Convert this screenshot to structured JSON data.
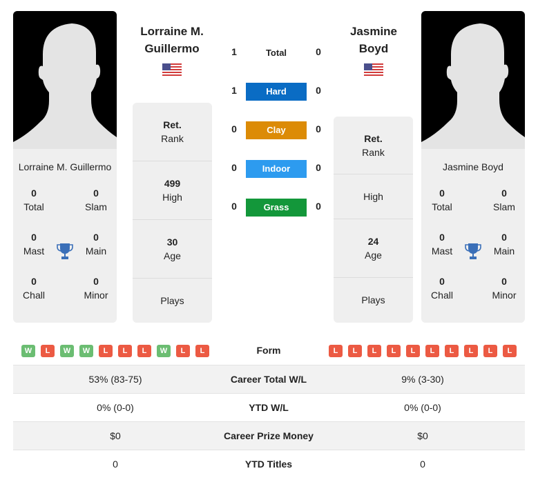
{
  "players": [
    {
      "name_line1": "Lorraine M.",
      "name_line2": "Guillermo",
      "full_name": "Lorraine M. Guillermo",
      "country_flag": "us-flag-icon",
      "titles": {
        "total": {
          "value": "0",
          "label": "Total"
        },
        "slam": {
          "value": "0",
          "label": "Slam"
        },
        "mast": {
          "value": "0",
          "label": "Mast"
        },
        "main": {
          "value": "0",
          "label": "Main"
        },
        "chall": {
          "value": "0",
          "label": "Chall"
        },
        "minor": {
          "value": "0",
          "label": "Minor"
        }
      },
      "stats": {
        "rank": {
          "value": "Ret.",
          "label": "Rank"
        },
        "high": {
          "value": "499",
          "label": "High"
        },
        "age": {
          "value": "30",
          "label": "Age"
        },
        "plays": {
          "value": "",
          "label": "Plays"
        }
      },
      "form": [
        "W",
        "L",
        "W",
        "W",
        "L",
        "L",
        "L",
        "W",
        "L",
        "L"
      ]
    },
    {
      "name_line1": "Jasmine",
      "name_line2": "Boyd",
      "full_name": "Jasmine Boyd",
      "country_flag": "us-flag-icon",
      "titles": {
        "total": {
          "value": "0",
          "label": "Total"
        },
        "slam": {
          "value": "0",
          "label": "Slam"
        },
        "mast": {
          "value": "0",
          "label": "Mast"
        },
        "main": {
          "value": "0",
          "label": "Main"
        },
        "chall": {
          "value": "0",
          "label": "Chall"
        },
        "minor": {
          "value": "0",
          "label": "Minor"
        }
      },
      "stats": {
        "rank": {
          "value": "Ret.",
          "label": "Rank"
        },
        "high": {
          "value": "",
          "label": "High"
        },
        "age": {
          "value": "24",
          "label": "Age"
        },
        "plays": {
          "value": "",
          "label": "Plays"
        }
      },
      "form": [
        "L",
        "L",
        "L",
        "L",
        "L",
        "L",
        "L",
        "L",
        "L",
        "L"
      ]
    }
  ],
  "head_to_head": [
    {
      "label": "Total",
      "left": "1",
      "right": "0",
      "color": ""
    },
    {
      "label": "Hard",
      "left": "1",
      "right": "0",
      "color": "#0a6cc4"
    },
    {
      "label": "Clay",
      "left": "0",
      "right": "0",
      "color": "#dc8b06"
    },
    {
      "label": "Indoor",
      "left": "0",
      "right": "0",
      "color": "#2d9bef"
    },
    {
      "label": "Grass",
      "left": "0",
      "right": "0",
      "color": "#13973a"
    }
  ],
  "form_label": "Form",
  "comparison": [
    {
      "label": "Career Total W/L",
      "left": "53% (83-75)",
      "right": "9% (3-30)"
    },
    {
      "label": "YTD W/L",
      "left": "0% (0-0)",
      "right": "0% (0-0)"
    },
    {
      "label": "Career Prize Money",
      "left": "$0",
      "right": "$0"
    },
    {
      "label": "YTD Titles",
      "left": "0",
      "right": "0"
    }
  ]
}
